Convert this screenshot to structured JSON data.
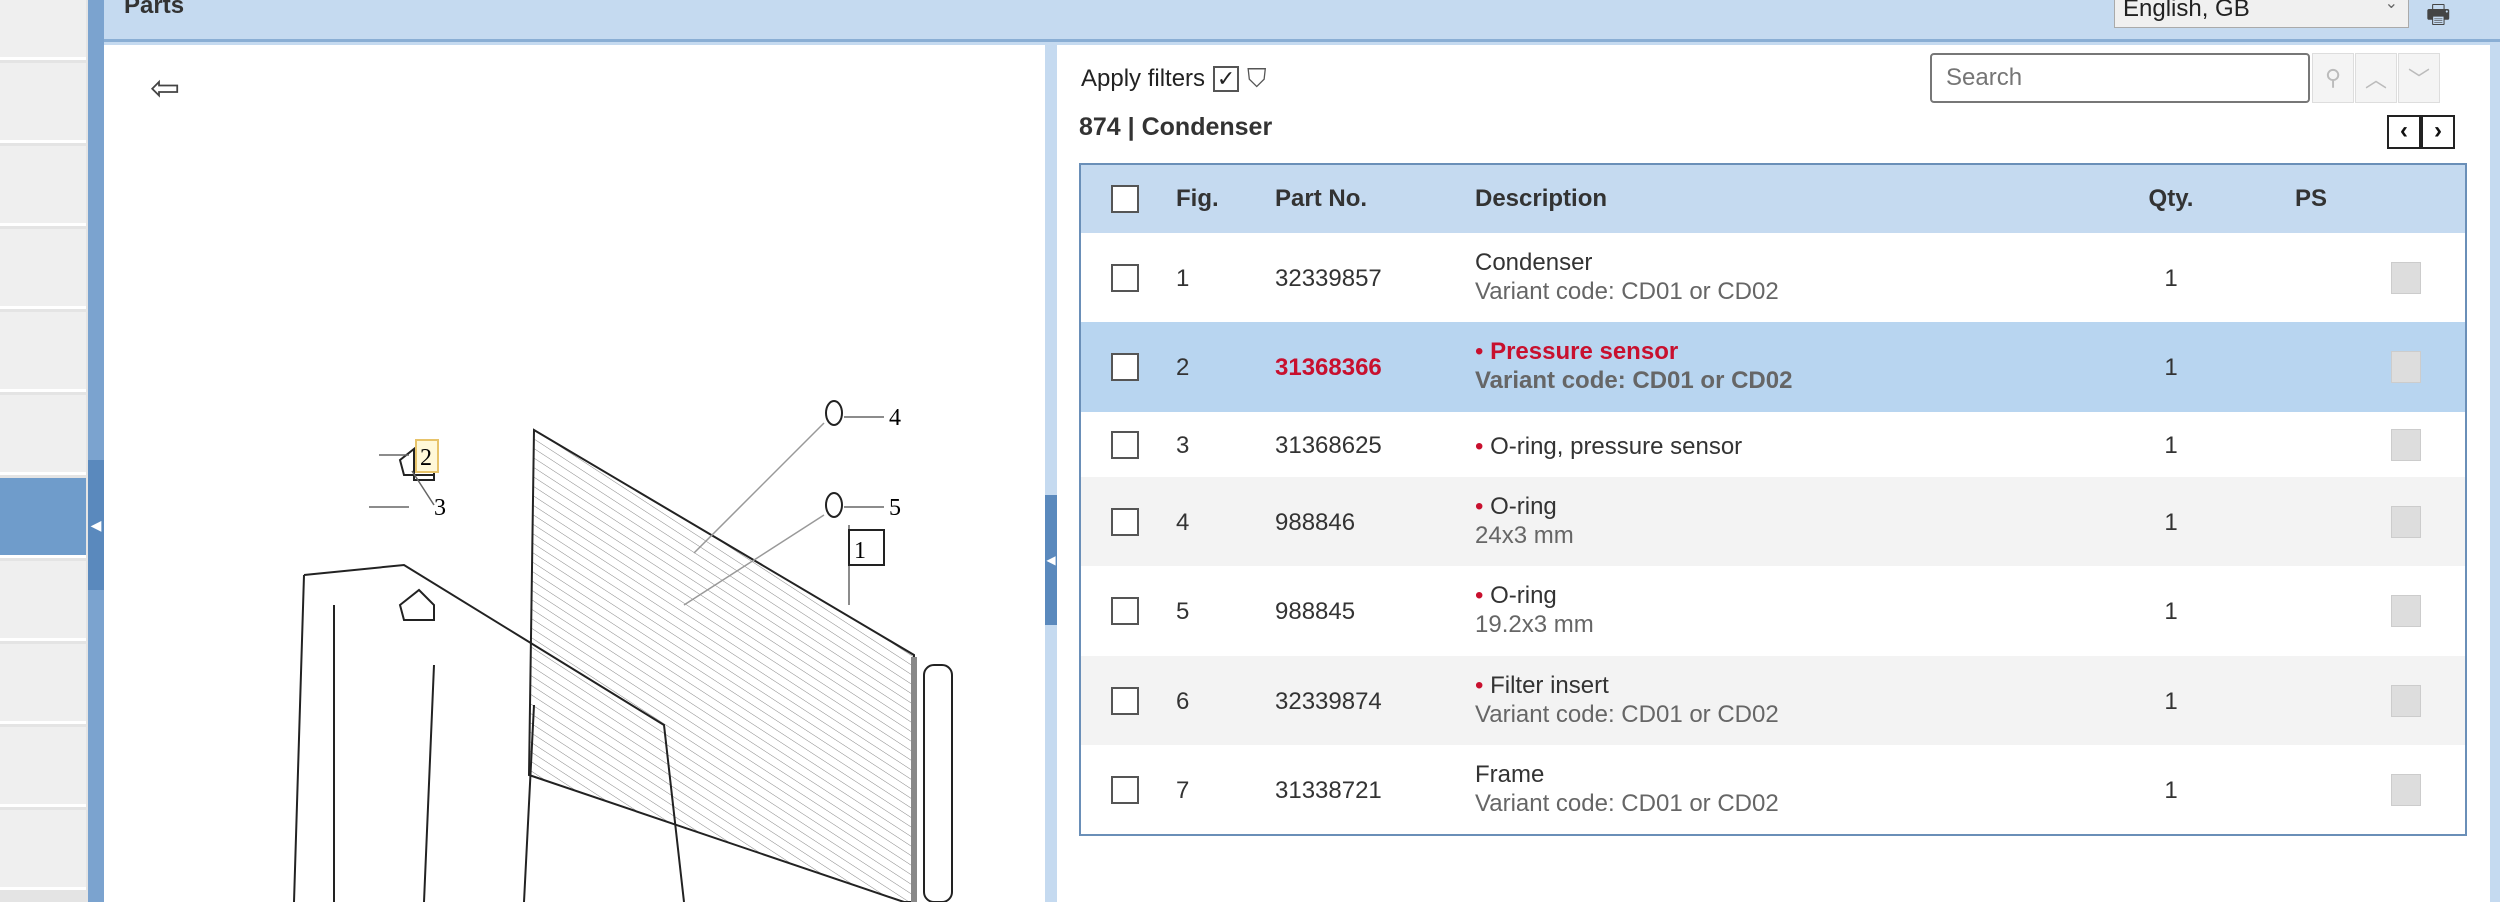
{
  "header": {
    "title": "Parts",
    "language": "English, GB"
  },
  "filters": {
    "label": "Apply filters",
    "checked": true
  },
  "search": {
    "placeholder": "Search"
  },
  "breadcrumb": "874  |  Condenser",
  "nav": {
    "prev": "‹",
    "next": "›"
  },
  "diagram": {
    "callouts": [
      "1",
      "2",
      "3",
      "4",
      "5"
    ]
  },
  "table": {
    "columns": [
      "Fig.",
      "Part No.",
      "Description",
      "Qty.",
      "PS"
    ],
    "rows": [
      {
        "fig": "1",
        "part_no": "32339857",
        "title": "Condenser",
        "sub": "Variant code: CD01 or CD02",
        "qty": "1",
        "bullet": false,
        "selected": false
      },
      {
        "fig": "2",
        "part_no": "31368366",
        "title": "Pressure sensor",
        "sub": "Variant code: CD01 or CD02",
        "qty": "1",
        "bullet": true,
        "selected": true
      },
      {
        "fig": "3",
        "part_no": "31368625",
        "title": "O-ring, pressure sensor",
        "sub": "",
        "qty": "1",
        "bullet": true,
        "selected": false
      },
      {
        "fig": "4",
        "part_no": "988846",
        "title": "O-ring",
        "sub": "24x3 mm",
        "qty": "1",
        "bullet": true,
        "selected": false
      },
      {
        "fig": "5",
        "part_no": "988845",
        "title": "O-ring",
        "sub": "19.2x3 mm",
        "qty": "1",
        "bullet": true,
        "selected": false
      },
      {
        "fig": "6",
        "part_no": "32339874",
        "title": "Filter insert",
        "sub": "Variant code: CD01 or CD02",
        "qty": "1",
        "bullet": true,
        "selected": false
      },
      {
        "fig": "7",
        "part_no": "31338721",
        "title": "Frame",
        "sub": "Variant code: CD01 or CD02",
        "qty": "1",
        "bullet": false,
        "selected": false
      }
    ]
  },
  "colors": {
    "accent": "#c8102e",
    "header_bg": "#c5daf0",
    "selected_row": "#b8d5f0"
  }
}
